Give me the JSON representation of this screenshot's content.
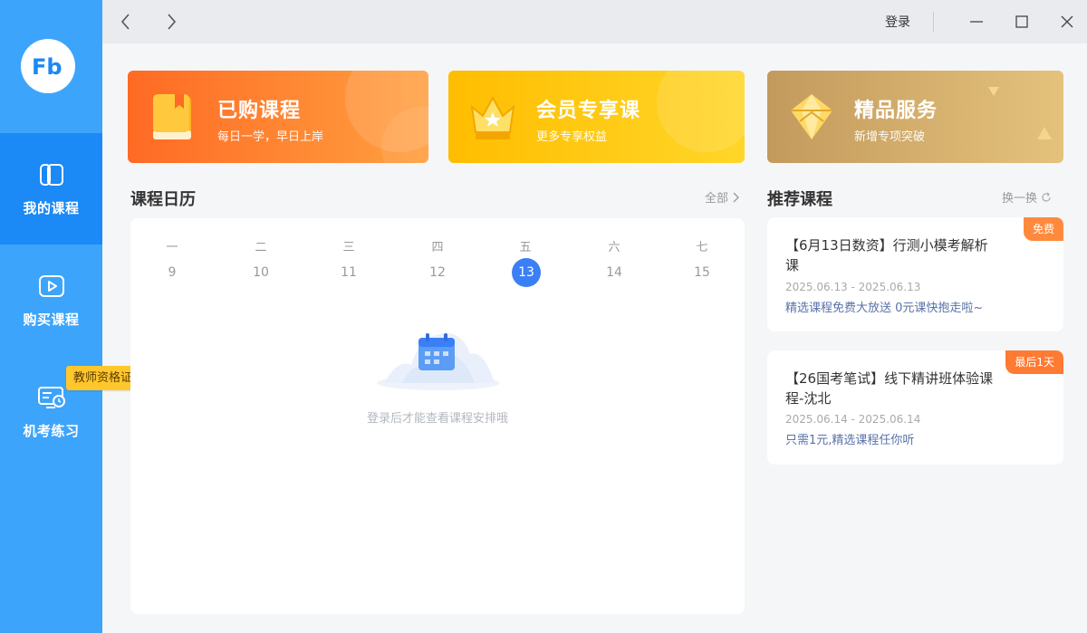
{
  "sidebar": {
    "logo_text": "Fb",
    "items": [
      {
        "label": "我的课程",
        "icon": "book-icon",
        "active": true
      },
      {
        "label": "购买课程",
        "icon": "play-icon",
        "active": false
      },
      {
        "label": "机考练习",
        "icon": "monitor-clock-icon",
        "active": false
      }
    ],
    "tag": "教师资格证"
  },
  "titlebar": {
    "login_label": "登录",
    "back_icon": "chevron-left-icon",
    "forward_icon": "chevron-right-icon",
    "minimize_icon": "minimize-icon",
    "maximize_icon": "maximize-icon",
    "close_icon": "close-icon"
  },
  "banners": [
    {
      "title": "已购课程",
      "subtitle": "每日一学，早日上岸",
      "icon": "book-icon",
      "color": "#ff6d2a"
    },
    {
      "title": "会员专享课",
      "subtitle": "更多专享权益",
      "icon": "crown-icon",
      "color": "#ffb400"
    },
    {
      "title": "精品服务",
      "subtitle": "新增专项突破",
      "icon": "diamond-icon",
      "color": "#c9a062"
    }
  ],
  "calendar": {
    "title": "课程日历",
    "all_label": "全部",
    "weekdays": [
      "一",
      "二",
      "三",
      "四",
      "五",
      "六",
      "七"
    ],
    "days": [
      "9",
      "10",
      "11",
      "12",
      "13",
      "14",
      "15"
    ],
    "today": "13",
    "empty_text": "登录后才能查看课程安排哦"
  },
  "recommend": {
    "title": "推荐课程",
    "refresh_label": "换一换",
    "courses": [
      {
        "title": "【6月13日数资】行测小模考解析课",
        "dates": "2025.06.13 - 2025.06.13",
        "desc": "精选课程免费大放送 0元课快抱走啦~",
        "tag": "免费"
      },
      {
        "title": "【26国考笔试】线下精讲班体验课程-沈北",
        "dates": "2025.06.14 - 2025.06.14",
        "desc": "只需1元,精选课程任你听",
        "tag": "最后1天"
      }
    ]
  }
}
